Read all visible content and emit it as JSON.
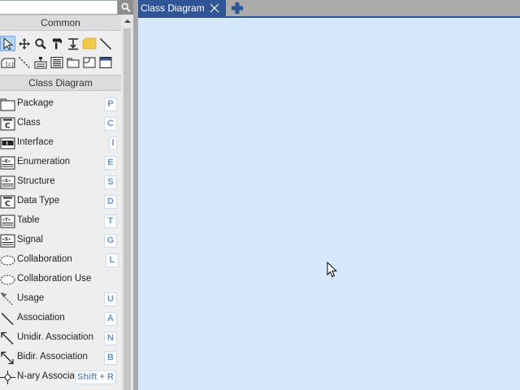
{
  "search": {
    "value": "",
    "placeholder": ""
  },
  "palette": {
    "common_header": "Common",
    "class_header": "Class Diagram",
    "tools": [
      "select-tool",
      "move-tool",
      "zoom-tool",
      "format-painter-tool",
      "anchor-tool",
      "note-tool",
      "line-tool",
      "constraint-tool",
      "dashed-line-tool",
      "stereotype-tool",
      "text-tool",
      "folder-tool",
      "frame-tool",
      "window-tool"
    ],
    "items": [
      {
        "label": "Package",
        "key": "P",
        "icon": "package-icon"
      },
      {
        "label": "Class",
        "key": "C",
        "icon": "class-icon"
      },
      {
        "label": "Interface",
        "key": "I",
        "icon": "interface-icon"
      },
      {
        "label": "Enumeration",
        "key": "E",
        "icon": "enumeration-icon"
      },
      {
        "label": "Structure",
        "key": "S",
        "icon": "structure-icon"
      },
      {
        "label": "Data Type",
        "key": "D",
        "icon": "data-type-icon"
      },
      {
        "label": "Table",
        "key": "T",
        "icon": "table-icon"
      },
      {
        "label": "Signal",
        "key": "G",
        "icon": "signal-icon"
      },
      {
        "label": "Collaboration",
        "key": "L",
        "icon": "collaboration-icon"
      },
      {
        "label": "Collaboration Use",
        "key": "",
        "icon": "collaboration-use-icon"
      },
      {
        "label": "Usage",
        "key": "U",
        "icon": "usage-icon"
      },
      {
        "label": "Association",
        "key": "A",
        "icon": "association-icon"
      },
      {
        "label": "Unidir. Association",
        "key": "N",
        "icon": "unidir-association-icon"
      },
      {
        "label": "Bidir. Association",
        "key": "B",
        "icon": "bidir-association-icon"
      },
      {
        "label": "N-ary Association",
        "key": "Shift + R",
        "icon": "nary-association-icon"
      }
    ]
  },
  "tabs": [
    {
      "label": "Class Diagram",
      "active": true
    }
  ],
  "colors": {
    "accent": "#2f5597",
    "canvas": "#d5e8fc",
    "shortcut_key": "#6a96c8"
  }
}
